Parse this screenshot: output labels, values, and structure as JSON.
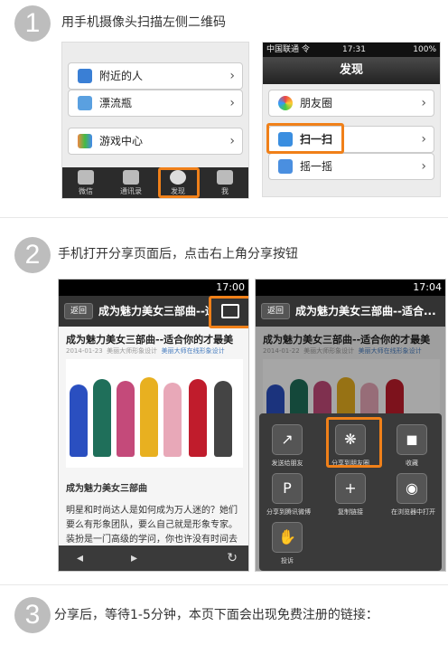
{
  "step1": {
    "num": "1",
    "text": "用手机摄像头扫描左侧二维码"
  },
  "step2": {
    "num": "2",
    "text": "手机打开分享页面后，点击右上角分享按钮"
  },
  "step3": {
    "num": "3",
    "text": "分享后，等待1-5分钟，本页下面会出现免费注册的链接："
  },
  "left_phone": {
    "rows": [
      "附近的人",
      "漂流瓶",
      "游戏中心"
    ],
    "tabs": [
      "微信",
      "通讯录",
      "发现",
      "我"
    ]
  },
  "right_phone": {
    "status_left": "中国联通 令",
    "status_time": "17:31",
    "status_right": "100%",
    "header": "发现",
    "rows": [
      "朋友圈",
      "扫一扫",
      "摇一摇"
    ]
  },
  "phone_a": {
    "status": "17:00",
    "back": "返回",
    "header": "成为魅力美女三部曲--适...",
    "title": "成为魅力美女三部曲--适合你的才最美",
    "meta_date": "2014-01-23",
    "meta_a": "美丽大师形象设计",
    "meta_b": "美丽大师在线形象设计",
    "subhead": "成为魅力美女三部曲",
    "para": "明星和时尚达人是如何成为万人迷的？她们要么有形象团队，要么自己就是形象专家。装扮是一门高级的学问，你也许没有时间去学习，但如果"
  },
  "phone_b": {
    "status": "17:04",
    "back": "返回",
    "header": "成为魅力美女三部曲--适合...",
    "title": "成为魅力美女三部曲--适合你的才最美",
    "meta_date": "2014-01-22",
    "meta_a": "美丽大师形象设计",
    "meta_b": "美丽大师在线形象设计",
    "share": [
      "发送给朋友",
      "分享到朋友圈",
      "收藏",
      "分享到腾讯微博",
      "复制链接",
      "在浏览器中打开",
      "投诉"
    ]
  },
  "colors": {
    "highlight": "#f08019",
    "step_circle": "#bdbdbd"
  }
}
